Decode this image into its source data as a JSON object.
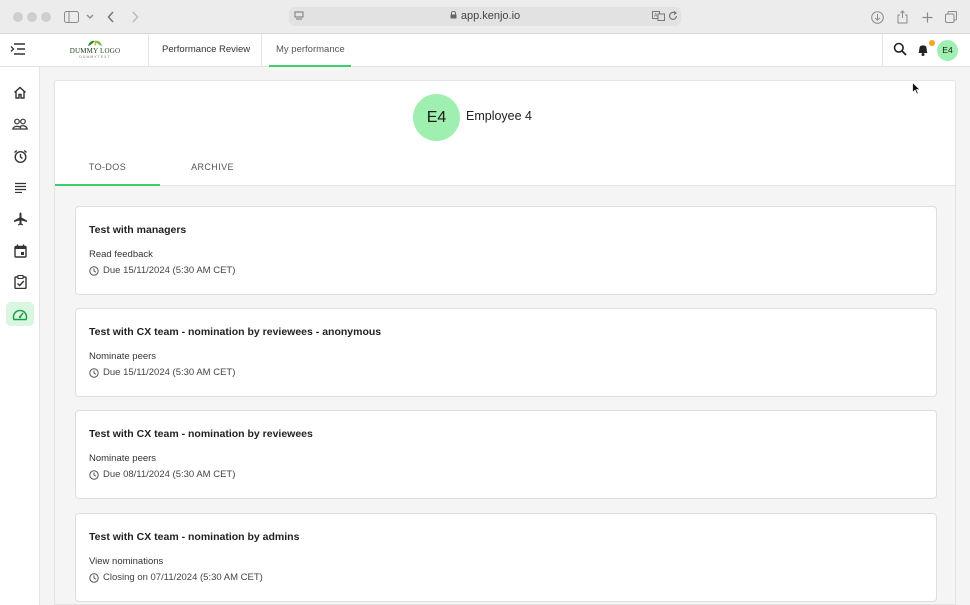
{
  "browser": {
    "url": "app.kenjo.io"
  },
  "header": {
    "logo_text": "DUMMY LOGO",
    "logo_subtext": "DUMMYTEXT",
    "nav_link": "Performance Review",
    "active_tab": "My performance",
    "user_initials": "E4",
    "accent_color": "#3ecf6a",
    "notification_color": "#f5a623"
  },
  "sidebar": {
    "items": [
      {
        "icon": "home-icon"
      },
      {
        "icon": "people-icon"
      },
      {
        "icon": "alarm-clock-icon"
      },
      {
        "icon": "list-icon"
      },
      {
        "icon": "airplane-icon"
      },
      {
        "icon": "calendar-icon"
      },
      {
        "icon": "checklist-icon"
      },
      {
        "icon": "performance-gauge-icon",
        "active": true
      }
    ]
  },
  "profile": {
    "initials": "E4",
    "name": "Employee 4",
    "avatar_color": "#9ff0b0"
  },
  "tabs": [
    {
      "label": "TO-DOS",
      "active": true
    },
    {
      "label": "ARCHIVE",
      "active": false
    }
  ],
  "cards": [
    {
      "title": "Test with managers",
      "action": "Read feedback",
      "due": "Due 15/11/2024 (5:30 AM CET)"
    },
    {
      "title": "Test with CX team - nomination by reviewees - anonymous",
      "action": "Nominate peers",
      "due": "Due 15/11/2024 (5:30 AM CET)"
    },
    {
      "title": "Test with CX team - nomination by reviewees",
      "action": "Nominate peers",
      "due": "Due 08/11/2024 (5:30 AM CET)"
    },
    {
      "title": "Test with CX team - nomination by admins",
      "action": "View nominations",
      "due": "Closing on 07/11/2024 (5:30 AM CET)"
    }
  ]
}
